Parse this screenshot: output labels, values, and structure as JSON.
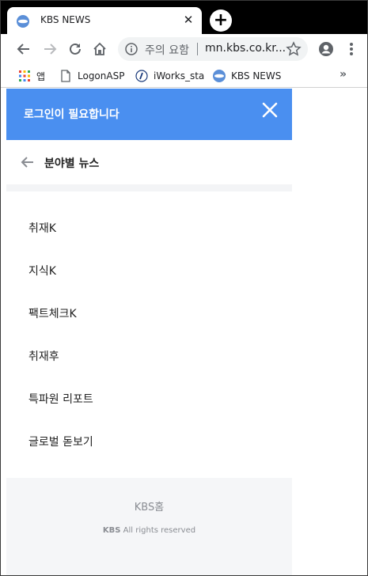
{
  "browser": {
    "tab_title": "KBS NEWS",
    "omnibox": {
      "warning": "주의 요함",
      "url": "mn.kbs.co.kr..."
    },
    "bookmarks": [
      {
        "label": "앱",
        "icon": "apps-grid-icon"
      },
      {
        "label": "LogonASP",
        "icon": "page-icon"
      },
      {
        "label": "iWorks_sta",
        "icon": "iworks-icon"
      },
      {
        "label": "KBS NEWS",
        "icon": "kbs-icon"
      }
    ],
    "more_bookmarks": "»"
  },
  "page": {
    "login_prompt": "로그인이 필요합니다",
    "section_title": "분야별 뉴스",
    "menu_items": [
      "취재K",
      "지식K",
      "팩트체크K",
      "취재후",
      "특파원 리포트",
      "글로벌 돋보기"
    ],
    "footer": {
      "home_link": "KBS홈",
      "copyright_brand": "KBS",
      "copyright_text": "All rights reserved"
    }
  },
  "colors": {
    "login_bar": "#4a8ff0",
    "footer_bg": "#f5f6f8"
  }
}
